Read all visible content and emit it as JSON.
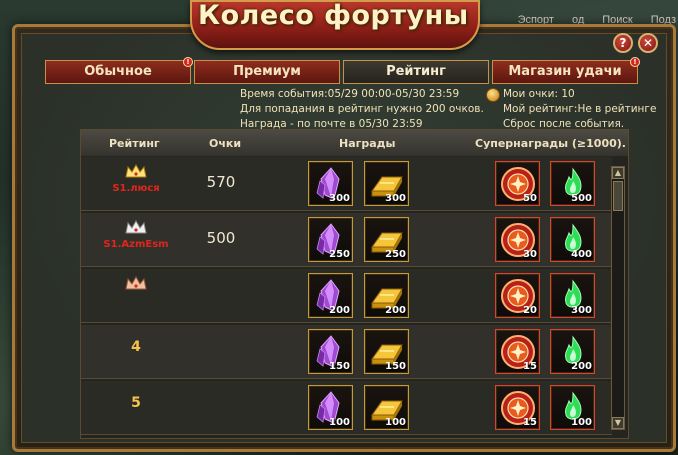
{
  "window": {
    "title": "Колесо фортуны",
    "help_label": "?",
    "close_label": "✕"
  },
  "topnav": {
    "items": [
      "Эспорт",
      "од",
      "Поиск",
      "Подз"
    ]
  },
  "tabs": [
    {
      "label": "Обычное",
      "badge": "!",
      "active": false
    },
    {
      "label": "Премиум",
      "badge": "",
      "active": false
    },
    {
      "label": "Рейтинг",
      "badge": "",
      "active": true
    },
    {
      "label": "Магазин удачи",
      "badge": "!",
      "active": false
    }
  ],
  "info": {
    "event_time": "Время события:05/29 00:00-05/30 23:59",
    "requirement": "Для попадания в рейтинг нужно 200 очков.",
    "reward_note": "Награда - по почте в 05/30 23:59",
    "my_points": "Мои очки: 10",
    "my_rating": "Мой рейтинг:Не в рейтинге",
    "reset_note": "Сброс после события."
  },
  "table": {
    "headers": {
      "rank": "Рейтинг",
      "points": "Очки",
      "rewards": "Награды",
      "super_rewards": "Супернаграды (≥1000)."
    },
    "rows": [
      {
        "rank_name": "S1.люся",
        "rank_num": "",
        "crown": "gold",
        "points": "570",
        "rewards": [
          "300",
          "300"
        ],
        "super": [
          "50",
          "500"
        ]
      },
      {
        "rank_name": "S1.AzmEsm",
        "rank_num": "",
        "crown": "silver",
        "points": "500",
        "rewards": [
          "250",
          "250"
        ],
        "super": [
          "30",
          "400"
        ]
      },
      {
        "rank_name": "",
        "rank_num": "",
        "crown": "bronze",
        "points": "",
        "rewards": [
          "200",
          "200"
        ],
        "super": [
          "20",
          "300"
        ]
      },
      {
        "rank_name": "",
        "rank_num": "4",
        "crown": "",
        "points": "",
        "rewards": [
          "150",
          "150"
        ],
        "super": [
          "15",
          "200"
        ]
      },
      {
        "rank_name": "",
        "rank_num": "5",
        "crown": "",
        "points": "",
        "rewards": [
          "100",
          "100"
        ],
        "super": [
          "15",
          "100"
        ]
      }
    ]
  },
  "icons": {
    "reward_1": "crystal-icon",
    "reward_2": "gold-bar-icon",
    "super_1": "fire-emblem-icon",
    "super_2": "green-flame-icon"
  },
  "colors": {
    "accent_gold": "#c49a3a",
    "tab_red": "#8e2d1e",
    "name_red": "#e0261c",
    "rank_gold": "#f7c34a"
  },
  "scroll": {
    "up": "▲",
    "down": "▼"
  }
}
